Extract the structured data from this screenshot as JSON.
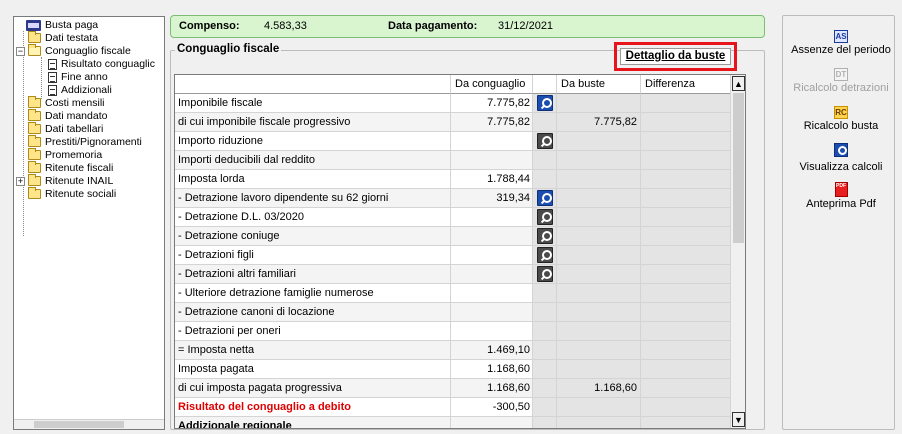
{
  "tree": {
    "items": [
      {
        "label": "Busta paga",
        "icon": "book-icon"
      },
      {
        "label": "Dati testata",
        "icon": "folder-icon"
      },
      {
        "label": "Conguaglio fiscale",
        "icon": "folder-open-icon",
        "expander": "−"
      },
      {
        "label": "Risultato conguaglic",
        "icon": "document-icon"
      },
      {
        "label": "Fine anno",
        "icon": "document-icon"
      },
      {
        "label": "Addizionali",
        "icon": "document-icon"
      },
      {
        "label": "Costi mensili",
        "icon": "folder-icon"
      },
      {
        "label": "Dati mandato",
        "icon": "folder-icon"
      },
      {
        "label": "Dati tabellari",
        "icon": "folder-icon"
      },
      {
        "label": "Prestiti/Pignoramenti",
        "icon": "folder-icon"
      },
      {
        "label": "Promemoria",
        "icon": "folder-icon"
      },
      {
        "label": "Ritenute fiscali",
        "icon": "folder-icon"
      },
      {
        "label": "Ritenute INAIL",
        "icon": "folder-icon",
        "expander": "+"
      },
      {
        "label": "Ritenute sociali",
        "icon": "folder-icon"
      }
    ]
  },
  "summary": {
    "compenso_label": "Compenso:",
    "compenso_value": "4.583,33",
    "data_label": "Data pagamento:",
    "data_value": "31/12/2021"
  },
  "groupbox": {
    "title": "Conguaglio fiscale",
    "dettaglio_button": "Dettaglio da buste"
  },
  "grid": {
    "headers": {
      "label": "",
      "da_conguaglio": "Da conguaglio",
      "icon": "",
      "da_buste": "Da buste",
      "differenza": "Differenza"
    },
    "rows": [
      {
        "label": "Imponibile fiscale",
        "dc": "7.775,82",
        "mag": "blue",
        "db": "",
        "diff": ""
      },
      {
        "label": "di cui imponibile fiscale progressivo",
        "dc": "7.775,82",
        "mag": "",
        "db": "7.775,82",
        "diff": ""
      },
      {
        "label": "Importo riduzione",
        "dc": "",
        "mag": "grey",
        "db": "",
        "diff": ""
      },
      {
        "label": "Importi deducibili dal reddito",
        "dc": "",
        "mag": "",
        "db": "",
        "diff": ""
      },
      {
        "label": "Imposta lorda",
        "dc": "1.788,44",
        "mag": "",
        "db": "",
        "diff": ""
      },
      {
        "label": "- Detrazione lavoro dipendente su 62 giorni",
        "dc": "319,34",
        "mag": "blue",
        "db": "",
        "diff": ""
      },
      {
        "label": "- Detrazione D.L. 03/2020",
        "dc": "",
        "mag": "grey",
        "db": "",
        "diff": ""
      },
      {
        "label": "- Detrazione coniuge",
        "dc": "",
        "mag": "grey",
        "db": "",
        "diff": ""
      },
      {
        "label": "- Detrazioni figli",
        "dc": "",
        "mag": "grey",
        "db": "",
        "diff": ""
      },
      {
        "label": "- Detrazioni altri familiari",
        "dc": "",
        "mag": "grey",
        "db": "",
        "diff": ""
      },
      {
        "label": "- Ulteriore detrazione famiglie numerose",
        "dc": "",
        "mag": "",
        "db": "",
        "diff": ""
      },
      {
        "label": "- Detrazione canoni di locazione",
        "dc": "",
        "mag": "",
        "db": "",
        "diff": ""
      },
      {
        "label": "- Detrazioni per oneri",
        "dc": "",
        "mag": "",
        "db": "",
        "diff": ""
      },
      {
        "label": "= Imposta netta",
        "dc": "1.469,10",
        "mag": "",
        "db": "",
        "diff": ""
      },
      {
        "label": "Imposta pagata",
        "dc": "1.168,60",
        "mag": "",
        "db": "",
        "diff": ""
      },
      {
        "label": "di cui imposta pagata progressiva",
        "dc": "1.168,60",
        "mag": "",
        "db": "1.168,60",
        "diff": ""
      },
      {
        "label": "Risultato del conguaglio a debito",
        "dc": "-300,50",
        "mag": "",
        "db": "",
        "diff": "",
        "style": "red"
      },
      {
        "label": "Addizionale regionale",
        "dc": "",
        "mag": "",
        "db": "",
        "diff": "",
        "style": "bold"
      }
    ]
  },
  "actions": [
    {
      "icon": "AS",
      "label": "Assenze del periodo",
      "enabled": true
    },
    {
      "icon": "DT",
      "label": "Ricalcolo detrazioni",
      "enabled": false
    },
    {
      "icon": "RC",
      "label": "Ricalcolo busta",
      "enabled": true
    },
    {
      "icon": "magnifier",
      "label": "Visualizza calcoli",
      "enabled": true
    },
    {
      "icon": "PDF",
      "label": "Anteprima Pdf",
      "enabled": true
    }
  ]
}
